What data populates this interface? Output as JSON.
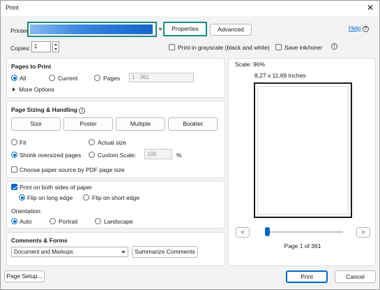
{
  "window": {
    "title": "Print",
    "close_glyph": "✕"
  },
  "printer": {
    "label": "Printer:",
    "selected": "",
    "properties_label": "Properties",
    "advanced_label": "Advanced",
    "help_label": "Help",
    "help_glyph": "?"
  },
  "copies": {
    "label": "Copies:",
    "value": "1",
    "grayscale_label": "Print in grayscale (black and white)",
    "grayscale_checked": false,
    "save_ink_label": "Save ink/toner",
    "save_ink_checked": false,
    "info_glyph": "i"
  },
  "pages_to_print": {
    "title": "Pages to Print",
    "options": [
      {
        "label": "All",
        "selected": true
      },
      {
        "label": "Current",
        "selected": false
      },
      {
        "label": "Pages",
        "selected": false
      }
    ],
    "pages_input": "1 - 361",
    "more_options_label": "More Options"
  },
  "sizing": {
    "title": "Page Sizing & Handling",
    "info_glyph": "i",
    "tabs": [
      "Size",
      "Poster",
      "Multiple",
      "Booklet"
    ],
    "fit_label": "Fit",
    "actual_size_label": "Actual size",
    "shrink_label": "Shrink oversized pages",
    "custom_scale_label": "Custom Scale:",
    "custom_scale_value": "100",
    "percent": "%",
    "paper_source_label": "Choose paper source by PDF page size"
  },
  "duplex": {
    "both_sides_label": "Print on both sides of paper",
    "both_sides_checked": true,
    "flip_long_label": "Flip on long edge",
    "flip_short_label": "Flip on short edge"
  },
  "orientation": {
    "title": "Orientation:",
    "options": [
      {
        "label": "Auto",
        "selected": true
      },
      {
        "label": "Portrait",
        "selected": false
      },
      {
        "label": "Landscape",
        "selected": false
      }
    ]
  },
  "comments": {
    "title": "Comments & Forms",
    "selected": "Document and Markups",
    "summarize_label": "Summarize Comments"
  },
  "preview": {
    "scale_text": "Scale: 96%",
    "paper_size": "8,27 x 11,69 Inches",
    "prev_glyph": "<",
    "next_glyph": ">",
    "page_status": "Page 1 of 361",
    "slider_fraction": 0.0
  },
  "footer": {
    "page_setup_label": "Page Setup...",
    "print_label": "Print",
    "cancel_label": "Cancel"
  },
  "colors": {
    "accent": "#0067c0",
    "highlight_border": "#1a8a7e",
    "printer_fill": "#1e6fd0"
  }
}
